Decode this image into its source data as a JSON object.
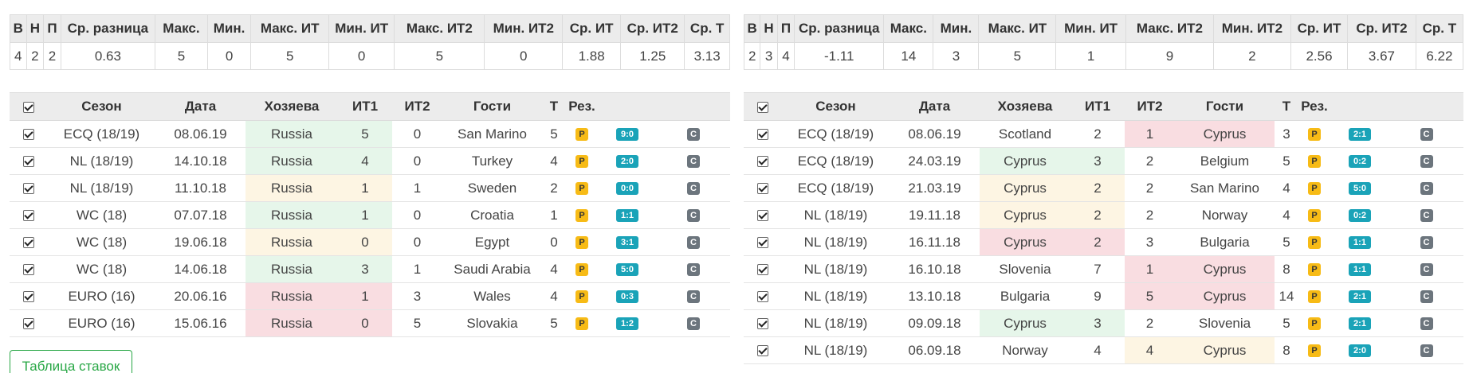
{
  "stats_headers": [
    "В",
    "Н",
    "П",
    "Ср. разница",
    "Макс.",
    "Мин.",
    "Макс. ИТ",
    "Мин. ИТ",
    "Макс. ИТ2",
    "Мин. ИТ2",
    "Ср. ИТ",
    "Ср. ИТ2",
    "Ср. Т"
  ],
  "match_headers": [
    "",
    "Сезон",
    "Дата",
    "Хозяева",
    "ИТ1",
    "ИТ2",
    "Гости",
    "Т",
    "Рез.",
    "",
    ""
  ],
  "left": {
    "stats": [
      "4",
      "2",
      "2",
      "0.63",
      "5",
      "0",
      "5",
      "0",
      "5",
      "0",
      "1.88",
      "1.25",
      "3.13"
    ],
    "matches": [
      {
        "season": "ECQ (18/19)",
        "date": "08.06.19",
        "home": "Russia",
        "it1": "5",
        "it2": "0",
        "away": "San Marino",
        "total": "5",
        "p": "P",
        "score": "9:0",
        "c": "C",
        "hl": "home",
        "tone": "g"
      },
      {
        "season": "NL (18/19)",
        "date": "14.10.18",
        "home": "Russia",
        "it1": "4",
        "it2": "0",
        "away": "Turkey",
        "total": "4",
        "p": "P",
        "score": "2:0",
        "c": "C",
        "hl": "home",
        "tone": "g"
      },
      {
        "season": "NL (18/19)",
        "date": "11.10.18",
        "home": "Russia",
        "it1": "1",
        "it2": "1",
        "away": "Sweden",
        "total": "2",
        "p": "P",
        "score": "0:0",
        "c": "C",
        "hl": "home",
        "tone": "y"
      },
      {
        "season": "WC (18)",
        "date": "07.07.18",
        "home": "Russia",
        "it1": "1",
        "it2": "0",
        "away": "Croatia",
        "total": "1",
        "p": "P",
        "score": "1:1",
        "c": "C",
        "hl": "home",
        "tone": "g"
      },
      {
        "season": "WC (18)",
        "date": "19.06.18",
        "home": "Russia",
        "it1": "0",
        "it2": "0",
        "away": "Egypt",
        "total": "0",
        "p": "P",
        "score": "3:1",
        "c": "C",
        "hl": "home",
        "tone": "y"
      },
      {
        "season": "WC (18)",
        "date": "14.06.18",
        "home": "Russia",
        "it1": "3",
        "it2": "1",
        "away": "Saudi Arabia",
        "total": "4",
        "p": "P",
        "score": "5:0",
        "c": "C",
        "hl": "home",
        "tone": "g"
      },
      {
        "season": "EURO (16)",
        "date": "20.06.16",
        "home": "Russia",
        "it1": "1",
        "it2": "3",
        "away": "Wales",
        "total": "4",
        "p": "P",
        "score": "0:3",
        "c": "C",
        "hl": "home",
        "tone": "r"
      },
      {
        "season": "EURO (16)",
        "date": "15.06.16",
        "home": "Russia",
        "it1": "0",
        "it2": "5",
        "away": "Slovakia",
        "total": "5",
        "p": "P",
        "score": "1:2",
        "c": "C",
        "hl": "home",
        "tone": "r"
      }
    ]
  },
  "right": {
    "stats": [
      "2",
      "3",
      "4",
      "-1.11",
      "14",
      "3",
      "5",
      "1",
      "9",
      "2",
      "2.56",
      "3.67",
      "6.22"
    ],
    "matches": [
      {
        "season": "ECQ (18/19)",
        "date": "08.06.19",
        "home": "Scotland",
        "it1": "2",
        "it2": "1",
        "away": "Cyprus",
        "total": "3",
        "p": "P",
        "score": "2:1",
        "c": "C",
        "hl": "away",
        "tone": "r"
      },
      {
        "season": "ECQ (18/19)",
        "date": "24.03.19",
        "home": "Cyprus",
        "it1": "3",
        "it2": "2",
        "away": "Belgium",
        "total": "5",
        "p": "P",
        "score": "0:2",
        "c": "C",
        "hl": "home",
        "tone": "g"
      },
      {
        "season": "ECQ (18/19)",
        "date": "21.03.19",
        "home": "Cyprus",
        "it1": "2",
        "it2": "2",
        "away": "San Marino",
        "total": "4",
        "p": "P",
        "score": "5:0",
        "c": "C",
        "hl": "home",
        "tone": "y"
      },
      {
        "season": "NL (18/19)",
        "date": "19.11.18",
        "home": "Cyprus",
        "it1": "2",
        "it2": "2",
        "away": "Norway",
        "total": "4",
        "p": "P",
        "score": "0:2",
        "c": "C",
        "hl": "home",
        "tone": "y"
      },
      {
        "season": "NL (18/19)",
        "date": "16.11.18",
        "home": "Cyprus",
        "it1": "2",
        "it2": "3",
        "away": "Bulgaria",
        "total": "5",
        "p": "P",
        "score": "1:1",
        "c": "C",
        "hl": "home",
        "tone": "r"
      },
      {
        "season": "NL (18/19)",
        "date": "16.10.18",
        "home": "Slovenia",
        "it1": "7",
        "it2": "1",
        "away": "Cyprus",
        "total": "8",
        "p": "P",
        "score": "1:1",
        "c": "C",
        "hl": "away",
        "tone": "r"
      },
      {
        "season": "NL (18/19)",
        "date": "13.10.18",
        "home": "Bulgaria",
        "it1": "9",
        "it2": "5",
        "away": "Cyprus",
        "total": "14",
        "p": "P",
        "score": "2:1",
        "c": "C",
        "hl": "away",
        "tone": "r"
      },
      {
        "season": "NL (18/19)",
        "date": "09.09.18",
        "home": "Cyprus",
        "it1": "3",
        "it2": "2",
        "away": "Slovenia",
        "total": "5",
        "p": "P",
        "score": "2:1",
        "c": "C",
        "hl": "home",
        "tone": "g"
      },
      {
        "season": "NL (18/19)",
        "date": "06.09.18",
        "home": "Norway",
        "it1": "4",
        "it2": "4",
        "away": "Cyprus",
        "total": "8",
        "p": "P",
        "score": "2:0",
        "c": "C",
        "hl": "away",
        "tone": "y"
      }
    ]
  },
  "bets_button": "Таблица ставок",
  "colors": {
    "win": "#e6f6ea",
    "draw": "#fdf5e3",
    "loss": "#f9dde1",
    "p_badge": "#f7bb16",
    "score_badge": "#1aa3b8",
    "c_badge": "#6c757d",
    "button": "#28a745"
  }
}
